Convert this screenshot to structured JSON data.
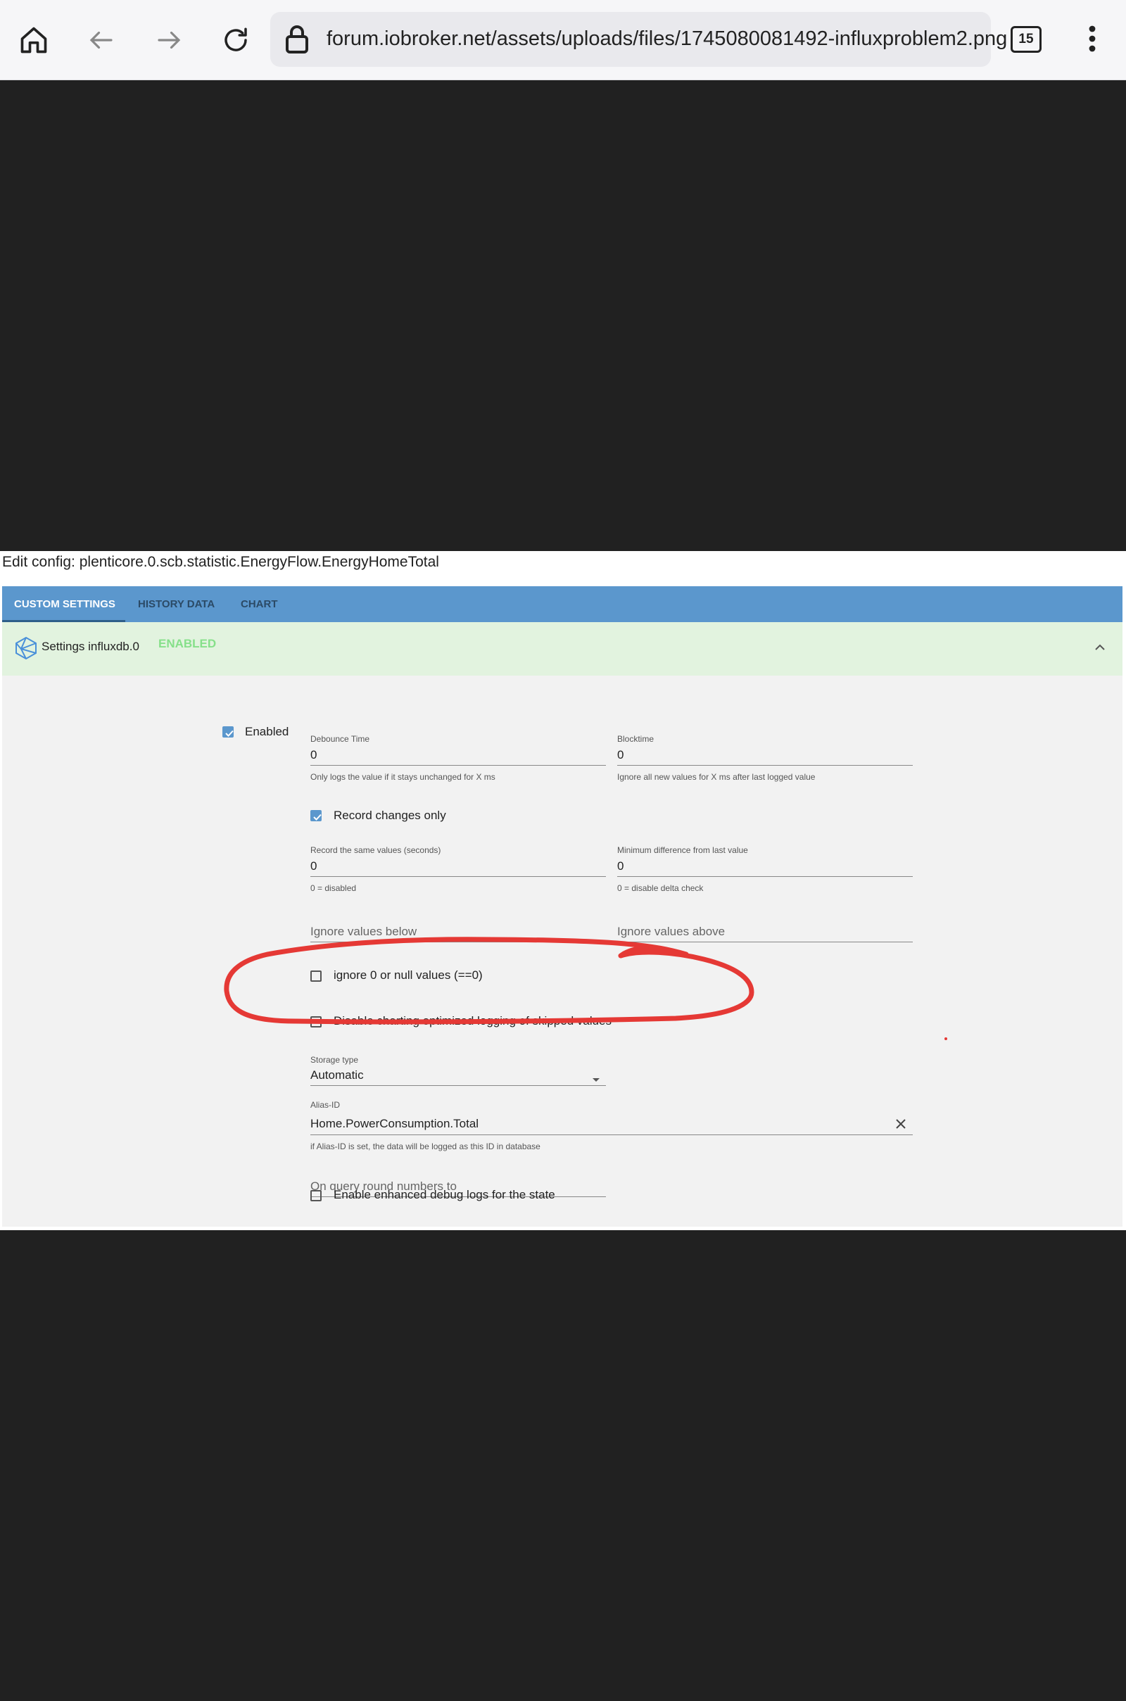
{
  "browser": {
    "url": "forum.iobroker.net/assets/uploads/files/1745080081492-influxproblem2.png",
    "tab_count": "15"
  },
  "config": {
    "title": "Edit config: plenticore.0.scb.statistic.EnergyFlow.EnergyHomeTotal",
    "tabs": [
      "CUSTOM SETTINGS",
      "HISTORY DATA",
      "CHART"
    ],
    "adapter_label": "Settings influxdb.0",
    "adapter_status": "ENABLED",
    "enabled_label": "Enabled",
    "debounce": {
      "caption": "Debounce Time",
      "value": "0",
      "help": "Only logs the value if it stays unchanged for X ms"
    },
    "blocktime": {
      "caption": "Blocktime",
      "value": "0",
      "help": "Ignore all new values for X ms after last logged value"
    },
    "record_changes_label": "Record changes only",
    "same_values": {
      "caption": "Record the same values (seconds)",
      "value": "0",
      "help": "0 = disabled"
    },
    "min_diff": {
      "caption": "Minimum difference from last value",
      "value": "0",
      "help": "0 = disable delta check"
    },
    "ignore_below_placeholder": "Ignore values below",
    "ignore_above_placeholder": "Ignore values above",
    "ignore_zero_label": "ignore 0 or null values (==0)",
    "disable_charting_label": "Disable charting optimized logging of skipped values",
    "storage": {
      "caption": "Storage type",
      "value": "Automatic"
    },
    "alias": {
      "caption": "Alias-ID",
      "value": "Home.PowerConsumption.Total",
      "help": "if Alias-ID is set, the data will be logged as this ID in database"
    },
    "round_placeholder": "On query round numbers to",
    "debug_label": "Enable enhanced debug logs for the state"
  },
  "colors": {
    "tabbar": "#5b97cd",
    "enabled_badge": "#86e08a",
    "annotation": "#e53935"
  }
}
